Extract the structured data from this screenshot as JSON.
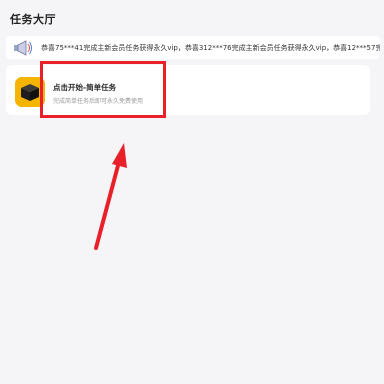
{
  "page": {
    "title": "任务大厅"
  },
  "announcement": {
    "icon": "megaphone-icon",
    "text": "恭喜75***41完成主新会员任务获得永久vip，恭喜312***76完成主新会员任务获得永久vip，恭喜12***57完成"
  },
  "task": {
    "icon": "box-icon",
    "title": "点击开始-简单任务",
    "subtitle": "完成简单任务后即可永久免费使用"
  },
  "annotation": {
    "highlight_color": "#e8202a"
  }
}
